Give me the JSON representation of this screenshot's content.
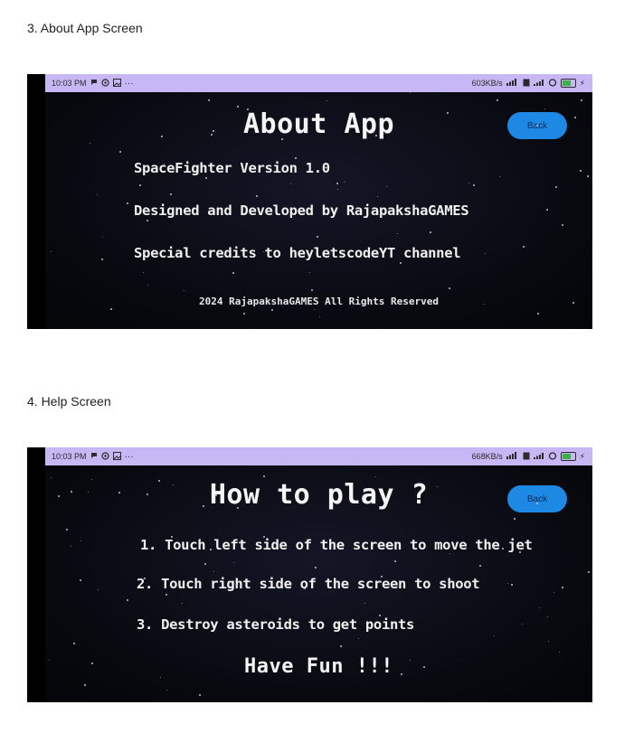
{
  "section_about": {
    "heading": "3. About App Screen",
    "status": {
      "time": "10:03 PM",
      "speed": "603KB/s"
    },
    "title": "About App",
    "back_label": "Back",
    "lines": [
      "SpaceFighter Version 1.0",
      "Designed and Developed by RajapakshaGAMES",
      "Special credits to heyletscodeYT channel"
    ],
    "footer": "2024 RajapakshaGAMES All Rights Reserved"
  },
  "section_help": {
    "heading": "4. Help Screen",
    "status": {
      "time": "10:03 PM",
      "speed": "668KB/s"
    },
    "title": "How to play ?",
    "back_label": "Back",
    "lines": [
      "1. Touch left side of the screen to move the jet",
      "2. Touch right side of the screen to shoot",
      "3. Destroy asteroids to get points"
    ],
    "closing": "Have Fun !!!"
  },
  "icons": {
    "status_left": [
      "message-icon",
      "settings-icon",
      "gallery-icon",
      "more-icon"
    ],
    "status_right": [
      "signal-icon",
      "sim-icon",
      "wifi-icon",
      "hotspot-icon",
      "battery-icon",
      "charging-icon"
    ]
  },
  "colors": {
    "status_bar": "#c7b8f5",
    "back_button": "#1e88e5",
    "game_bg": "#05060c"
  }
}
